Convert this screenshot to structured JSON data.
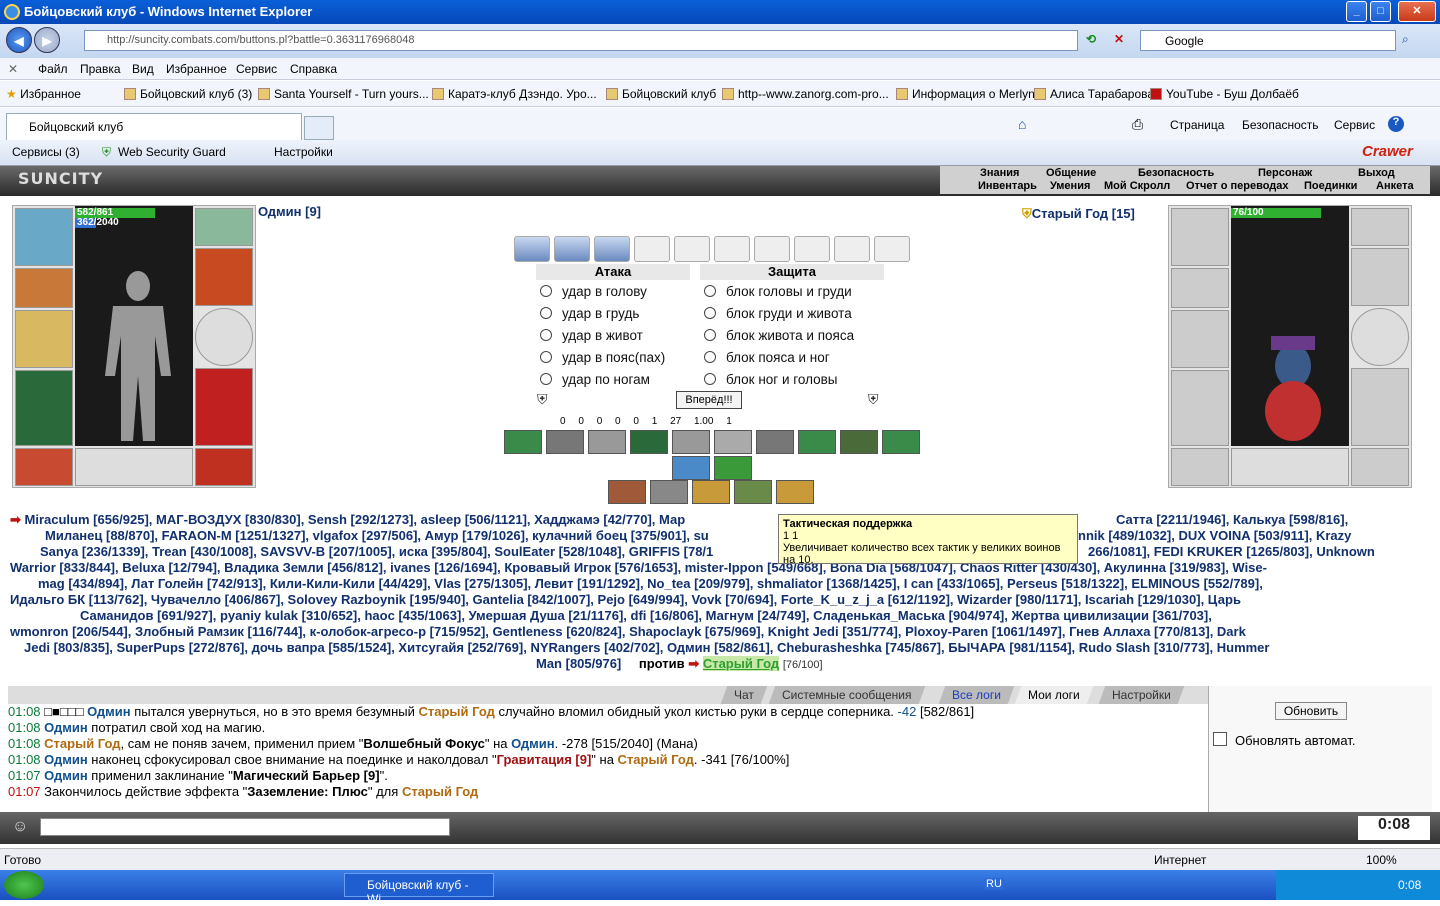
{
  "window": {
    "title": "Бойцовский клуб - Windows Internet Explorer"
  },
  "address": {
    "url": "http://suncity.combats.com/buttons.pl?battle=0.3631176968048",
    "search": "Google"
  },
  "menu": [
    "Файл",
    "Правка",
    "Вид",
    "Избранное",
    "Сервис",
    "Справка"
  ],
  "favorites": {
    "label": "Избранное",
    "items": [
      "Бойцовский клуб (3)",
      "Santa Yourself - Turn yours...",
      "Каратэ-клуб Дзэндо. Уро...",
      "Бойцовский клуб",
      "http--www.zanorg.com-pro...",
      "Информация о Merlyn",
      "Алиса Тарабарова",
      "YouTube - Буш Долбаёб"
    ]
  },
  "tab": {
    "label": "Бойцовский клуб"
  },
  "tab_tools": [
    "Страница",
    "Безопасность",
    "Сервис"
  ],
  "toolbar2": [
    "Сервисы (3)",
    "Web Security Guard",
    "Настройки"
  ],
  "crawler": "Crawer",
  "game": {
    "logo": "SUNCITY",
    "menu1": [
      "Знания",
      "Общение",
      "Безопасность",
      "Персонаж",
      "Выход"
    ],
    "menu2": [
      "Инвентарь",
      "Умения",
      "Мой Скролл",
      "Отчет о переводах",
      "Поединки",
      "Анкета"
    ],
    "me": {
      "name": "Одмин [9]",
      "hp": "582/861",
      "mana": "362/2040",
      "hp_frac": 0.68,
      "mana_frac": 0.18
    },
    "enemy": {
      "name": "Старый Год [15]",
      "hp": "76/100",
      "hp_frac": 0.76
    },
    "attack_title": "Атака",
    "defense_title": "Защита",
    "attacks": [
      "удар в голову",
      "удар в грудь",
      "удар в живот",
      "удар в пояс(пах)",
      "удар по ногам"
    ],
    "blocks": [
      "блок головы и груди",
      "блок груди и живота",
      "блок живота и пояса",
      "блок пояса и ног",
      "блок ног и головы"
    ],
    "go": "Вперёд!!!",
    "stats": [
      "0",
      "0",
      "0",
      "0",
      "0",
      "1",
      "27",
      "1.00",
      "1"
    ],
    "tooltip": {
      "title": "Тактическая поддержка",
      "counts": "1   1",
      "text": "Увеличивает количество всех тактик у великих воинов на 10."
    },
    "players_html": [
      "Miraculum [656/925], МАГ-ВОЗДУХ [830/830], Sensh [292/1273], asleep [506/1121], Хадджамэ [42/770], Мар",
      "Сатта [2211/1946], Калькуа [598/816],",
      "Миланец [88/870], FARAON-M [1251/1327], vlgafox [297/506], Амур [179/1026], кулачний боец [375/901], su",
      "nnik [489/1032], DUX VOINA [503/911], Krazy",
      "Sanya [236/1339], Trean [430/1008], SAVSVV-B [207/1005], иска [395/804], SoulEater [528/1048], GRIFFIS [78/1",
      "266/1081], FEDI KRUKER [1265/803], Unknown",
      "Warrior [833/844], Beluxa [12/794], Владика Земли [456/812], ivanes [126/1694], Кровавый Игрок [576/1653], mister-Ippon [549/668], Bona Dia [568/1047], Chaos Ritter [430/430], Акулинна [319/983], Wise-",
      "mag [434/894], Лат Голейн [742/913], Кили-Кили-Кили [44/429], Vlas [275/1305], Левит [191/1292], No_tea [209/979], shmaliator [1368/1425], I can [433/1065], Perseus [518/1322], ELMINOUS [552/789],",
      "Идальго БК [113/762], Чувачелло [406/867], Solovey Razboynik [195/940], Gantelia [842/1007], Pejo [649/994], Vovk [70/694], Forte_K_u_z_j_a [612/1192], Wizarder [980/1171], Iscariah [129/1030], Царь",
      "Саманидов [691/927], pyaniy kulak [310/652], haoc [435/1063], Умершая Душа [21/1176], dfi [16/806], Магнум [24/749], Сладенькая_Маська [904/974], Жертва цивилизации [361/703],",
      "wmonron [206/544], Злобный Рамзик [116/744], к-олобок-агресо-р [715/952], Gentleness [620/824], Shapoclayk [675/969], Knight Jedi [351/774], Ploxoy-Paren [1061/1497], Гнев Аллаха [770/813], Dark",
      "Jedi [803/835], SuperPups [272/876], дочь вапра [585/1524], Хитсугайя [252/769], NYRangers [402/702], Одмин [582/861], Cheburasheshka [745/867], БЫЧАРА [981/1154], Rudo Slash [310/773], Hummer",
      "Man [805/976]",
      "против",
      "Старый Год",
      "[76/100]"
    ]
  },
  "chat_tabs": [
    "Чат",
    "Системные сообщения",
    "Все логи",
    "Мои логи",
    "Настройки"
  ],
  "log": [
    {
      "t": "01:08",
      "parts": [
        "□■□□□",
        "Одмин",
        " пытался увернуться, но в это время безумный ",
        "Старый Год",
        " случайно вломил обидный укол кистью руки в сердце соперника. ",
        "-42",
        " [582/861]"
      ]
    },
    {
      "t": "01:08",
      "parts": [
        "",
        "Одмин",
        " потратил свой ход на магию.",
        "",
        "",
        "",
        ""
      ]
    },
    {
      "t": "01:08",
      "parts": [
        "",
        "Старый Год",
        ", сам не поняв зачем, применил прием \"",
        "Волшебный Фокус",
        "\" на ",
        "Одмин",
        ". -278 [515/2040] (Мана)"
      ]
    },
    {
      "t": "01:08",
      "parts": [
        "",
        "Одмин",
        " наконец сфокусировал свое внимание на поединке и наколдовал \"",
        "Гравитация [9]",
        "\" на ",
        "Старый Год",
        ". -341 [76/100%]"
      ]
    },
    {
      "t": "01:07",
      "parts": [
        "",
        "Одмин",
        " применил заклинание \"",
        "Магический Барьер [9]",
        "\".",
        "",
        ""
      ]
    },
    {
      "t": "01:07",
      "parts": [
        "",
        "",
        "Закончилось действие эффекта \"",
        "Заземление: Плюс",
        "\" для ",
        "Старый Год",
        ""
      ]
    }
  ],
  "right": {
    "refresh": "Обновить",
    "auto": "Обновлять автомат."
  },
  "clock": "0:08",
  "status": {
    "left": "Готово",
    "zone": "Интернет",
    "zoom": "100%"
  },
  "taskbar": {
    "item": "Бойцовский клуб - Wi...",
    "lang": "RU",
    "time": "0:08"
  }
}
